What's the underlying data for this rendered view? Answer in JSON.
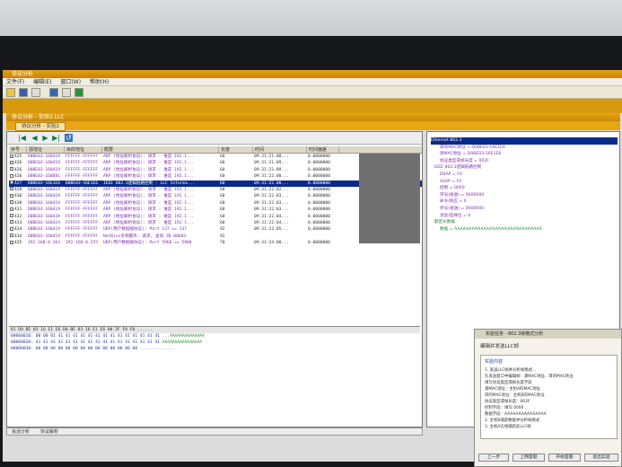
{
  "app": {
    "title": "协议分析",
    "menu": [
      "文件(F)",
      "编辑(E)",
      "窗口(W)",
      "帮助(H)"
    ],
    "doc_title": "协议分析 - 实验2.LLC",
    "doc_tab": "协议分析 - 实验2"
  },
  "packets": {
    "columns": [
      "序号",
      "源地址",
      "目的地址",
      "概要",
      "长度",
      "时间",
      "时间偏差"
    ],
    "rows": [
      {
        "no": "425",
        "src": "D0BE03-160419",
        "dst": "FFFFFF-FFFFFF",
        "summary": "ARP (地址解析协议): 请求 : 谁是 192.1...",
        "len": "60",
        "time": "09:31:21.08...",
        "delta": "0.0000000"
      },
      {
        "no": "426",
        "src": "D0BE03-160419",
        "dst": "FFFFFF-FFFFFF",
        "summary": "ARP (地址解析协议): 请求 : 谁是 192.1...",
        "len": "60",
        "time": "09:31:21.09...",
        "delta": "0.0000000"
      },
      {
        "no": "426",
        "src": "D0BE03-160419",
        "dst": "FFFFFF-FFFFFF",
        "summary": "ARP (地址解析协议): 请求 : 谁是 192.1...",
        "len": "60",
        "time": "09:31:21.09...",
        "delta": "0.0000000"
      },
      {
        "no": "426",
        "src": "D0BE03-160D81",
        "dst": "FFFFFF-FFFFFF",
        "summary": "ARP (地址解析协议): 请求 : 谁是 192.1...",
        "len": "60",
        "time": "09:31:22.00...",
        "delta": "0.0000000"
      },
      {
        "no": "427",
        "src": "D0BE03-16E1E6",
        "dst": "D0BE03-16E1E6",
        "summary": "IEEE 802.3逻辑链路控制 - LLC Informa...",
        "len": "60",
        "time": "09:31:22.00...",
        "delta": "0.0000000",
        "selected": true
      },
      {
        "no": "429",
        "src": "D0BE03-160419",
        "dst": "FFFFFF-FFFFFF",
        "summary": "ARP (地址解析协议): 请求 : 谁是 192.1...",
        "len": "60",
        "time": "09:31:22.02...",
        "delta": "0.0000000"
      },
      {
        "no": "430",
        "src": "D0BE03-160419",
        "dst": "FFFFFF-FFFFFF",
        "summary": "ARP (地址解析协议): 请求 : 谁是 192.1...",
        "len": "60",
        "time": "09:31:22.03...",
        "delta": "0.0000000"
      },
      {
        "no": "430",
        "src": "D0BE03-160419",
        "dst": "FFFFFF-FFFFFF",
        "summary": "ARP (地址解析协议): 请求 : 谁是 192.1...",
        "len": "60",
        "time": "09:31:22.03...",
        "delta": "0.0000000"
      },
      {
        "no": "431",
        "src": "D0BE03-160419",
        "dst": "FFFFFF-FFFFFF",
        "summary": "ARP (地址解析协议): 请求 : 谁是 192.1...",
        "len": "60",
        "time": "09:31:22.03...",
        "delta": "0.0000000"
      },
      {
        "no": "432",
        "src": "D0BE03-16043A",
        "dst": "FFFFFF-FFFFFF",
        "summary": "ARP (地址解析协议): 请求 : 谁是 192.1...",
        "len": "60",
        "time": "09:31:22.04...",
        "delta": "0.0000000"
      },
      {
        "no": "433",
        "src": "D0BE03-160419",
        "dst": "FFFFFF-FFFFFF",
        "summary": "ARP (地址解析协议): 请求 : 谁是 192.1...",
        "len": "60",
        "time": "09:31:22.04...",
        "delta": "0.0000000"
      },
      {
        "no": "434",
        "src": "D0BE03-160419",
        "dst": "FFFFFF-FFFFFF",
        "summary": "UDP(用户数据报协议): Port 137 == 137",
        "len": "92",
        "time": "09:31:22.05...",
        "delta": "0.0000000"
      },
      {
        "no": "434",
        "src": "D0BE03-160419",
        "dst": "FFFFFF-FFFFFF",
        "summary": "NetBios名称服务: 请求, 查询 ZB 00683",
        "len": "92",
        "time": "",
        "delta": ""
      },
      {
        "no": "435",
        "src": "192.168.0.163",
        "dst": "192.168.0.255",
        "summary": "UDP(用户数据报协议): Port 5968 == 5968",
        "len": "70",
        "time": "09:31:24.00...",
        "delta": "0.0000000"
      }
    ]
  },
  "hex": {
    "header": "01 D0 BE 03 16 E1 E6 D0 BE 03 16 E1 E6 00 2F F0 F0 ......",
    "lines": [
      {
        "offset": "00000010:",
        "bytes": "00 00 01 41 41 41 41 41 41 41 41 41 41 41 41 41 41",
        "ascii": "...AAAAAAAAAAAAAA"
      },
      {
        "offset": "00000020:",
        "bytes": "41 41 41 41 41 41 41 41 41 41 41 41 41 41 41 41 41",
        "ascii": "AAAAAAAAAAAAAAAA"
      },
      {
        "offset": "00000030:",
        "bytes": "00 00 00 00 00 00 00 00 00 00 00 00 00 00",
        "ascii": ".............."
      }
    ]
  },
  "bottom_tabs": [
    "会话分析",
    "协议解析"
  ],
  "detail_tree": [
    {
      "text": "Ethernet 802.3",
      "cls": "hdr"
    },
    {
      "text": "目的MAC地址 = D0BE03-16E1E6",
      "cls": ""
    },
    {
      "text": "源MAC地址 = D0BE03-16E1E6",
      "cls": ""
    },
    {
      "text": "协议类型或帧长度 = 002F",
      "cls": ""
    },
    {
      "text": "IEEE 802.2逻辑链路控制",
      "cls": ""
    },
    {
      "text": "DSAP = F0",
      "cls": ""
    },
    {
      "text": "SSAP = F0",
      "cls": ""
    },
    {
      "text": "控制 = 0000",
      "cls": ""
    },
    {
      "text": "序号(接收) = 0000000",
      "cls": ""
    },
    {
      "text": "命令/响应 = 0",
      "cls": ""
    },
    {
      "text": "序号(发送) = 0000000",
      "cls": ""
    },
    {
      "text": "消息/选择位 = 0",
      "cls": ""
    },
    {
      "text": "额定长数据",
      "cls": "g"
    },
    {
      "text": "数据 = AAAAAAAAAAAAAAAAAAAAAAAAAAAAAA",
      "cls": "g"
    }
  ],
  "dialog": {
    "title": "实验任务 - 802.3帧格式分析",
    "heading": "编辑并发送LLC帧",
    "box_title": "实验内容",
    "lines": [
      "1. 发送LLC帧并分析帧格式...",
      "在发送窗口中编辑帧：源MAC地址、目的MAC地址",
      "填写协议类型或帧长度字段",
      "源MAC地址：主机A的MAC地址",
      "目的MAC地址：主机B的MAC地址",
      "协议类型或帧长度：002F",
      "控制字段：填写 0000",
      "数据字段：AAAAAAAAAAAAAAA",
      "2. 主机B捕获数据并分析帧格式",
      "3. 主机A在线捕获此LLC帧"
    ],
    "buttons": [
      "上一步",
      "上网答题",
      "开始答题",
      "退出实验"
    ]
  }
}
